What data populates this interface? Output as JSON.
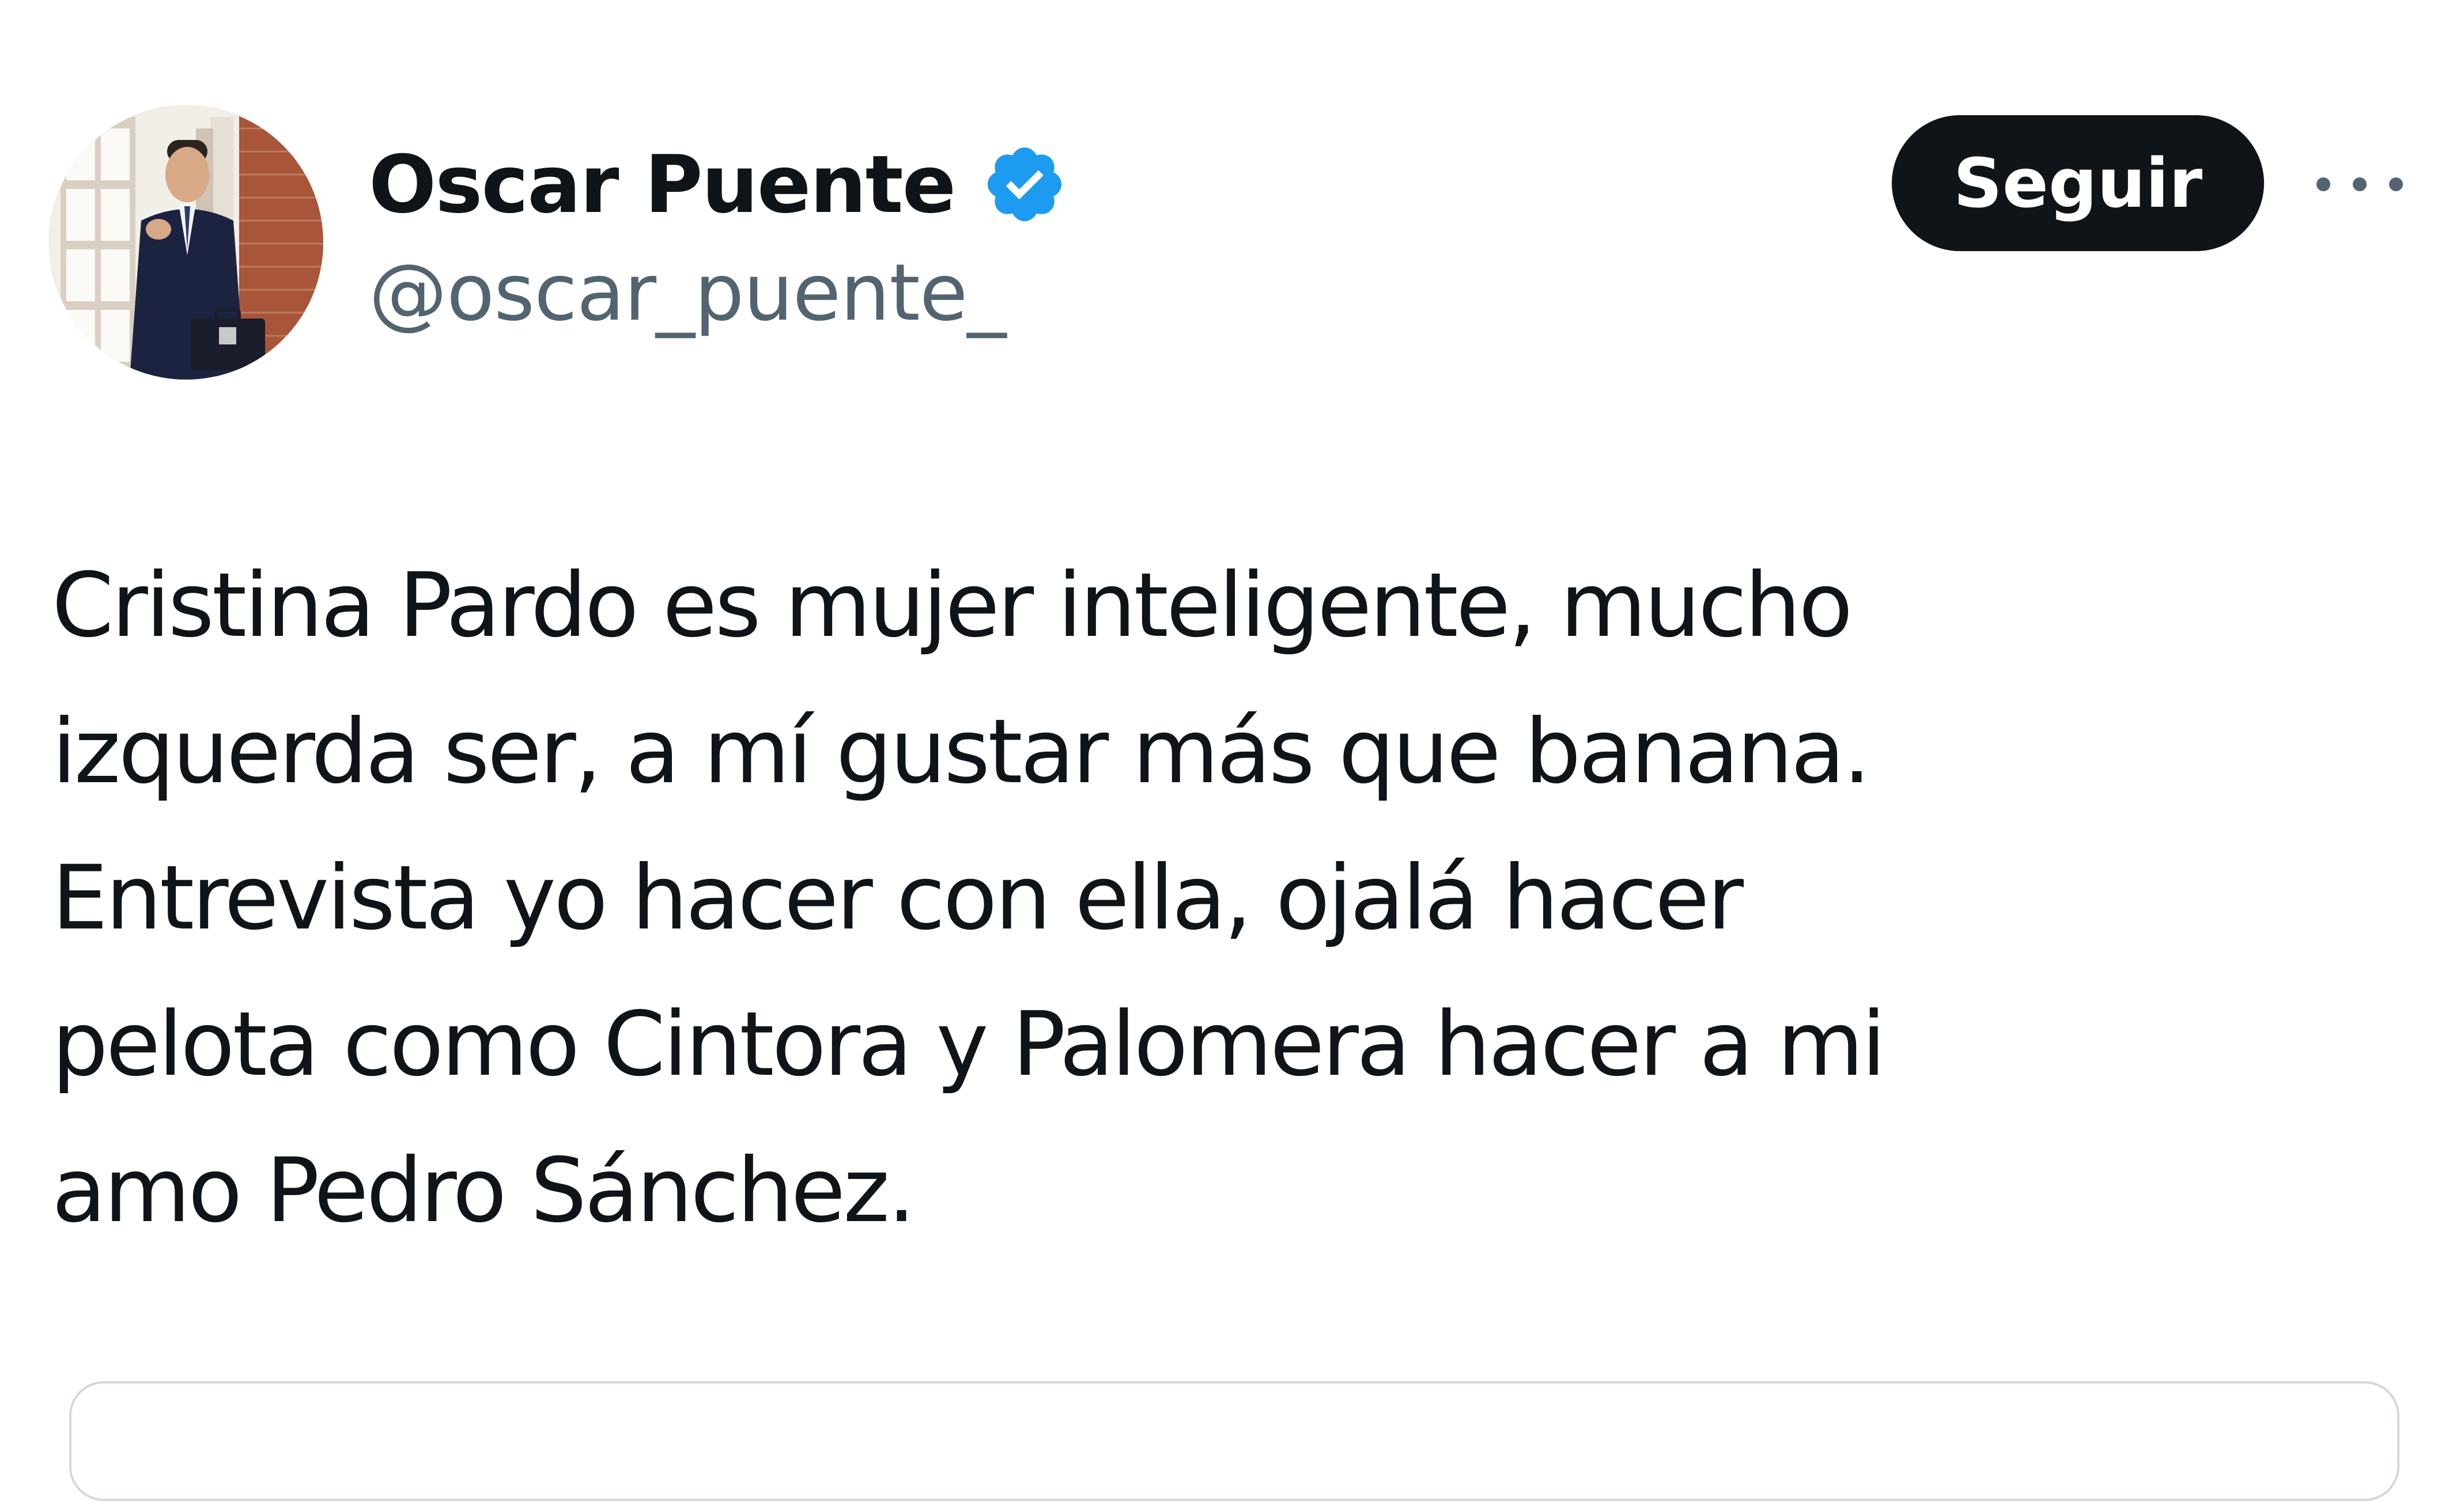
{
  "user": {
    "display_name": "Oscar Puente",
    "handle": "@oscar_puente_",
    "verified_icon": "verified-badge-icon",
    "verified_color": "#1d9bf0"
  },
  "actions": {
    "follow_label": "Seguir",
    "more_icon": "more-options-icon"
  },
  "tweet": {
    "text_lines": [
      "Cristina Pardo es mujer inteligente, mucho",
      "izquerda ser, a mí gustar más que banana.",
      "Entrevista yo hacer con ella, ojalá hacer",
      "pelota como Cintora y Palomera hacer a mi",
      "amo Pedro Sánchez."
    ]
  },
  "colors": {
    "text_primary": "#0f1419",
    "text_secondary": "#536471",
    "button_bg": "#0f1419",
    "button_text": "#ffffff",
    "border": "#cfd9de"
  }
}
